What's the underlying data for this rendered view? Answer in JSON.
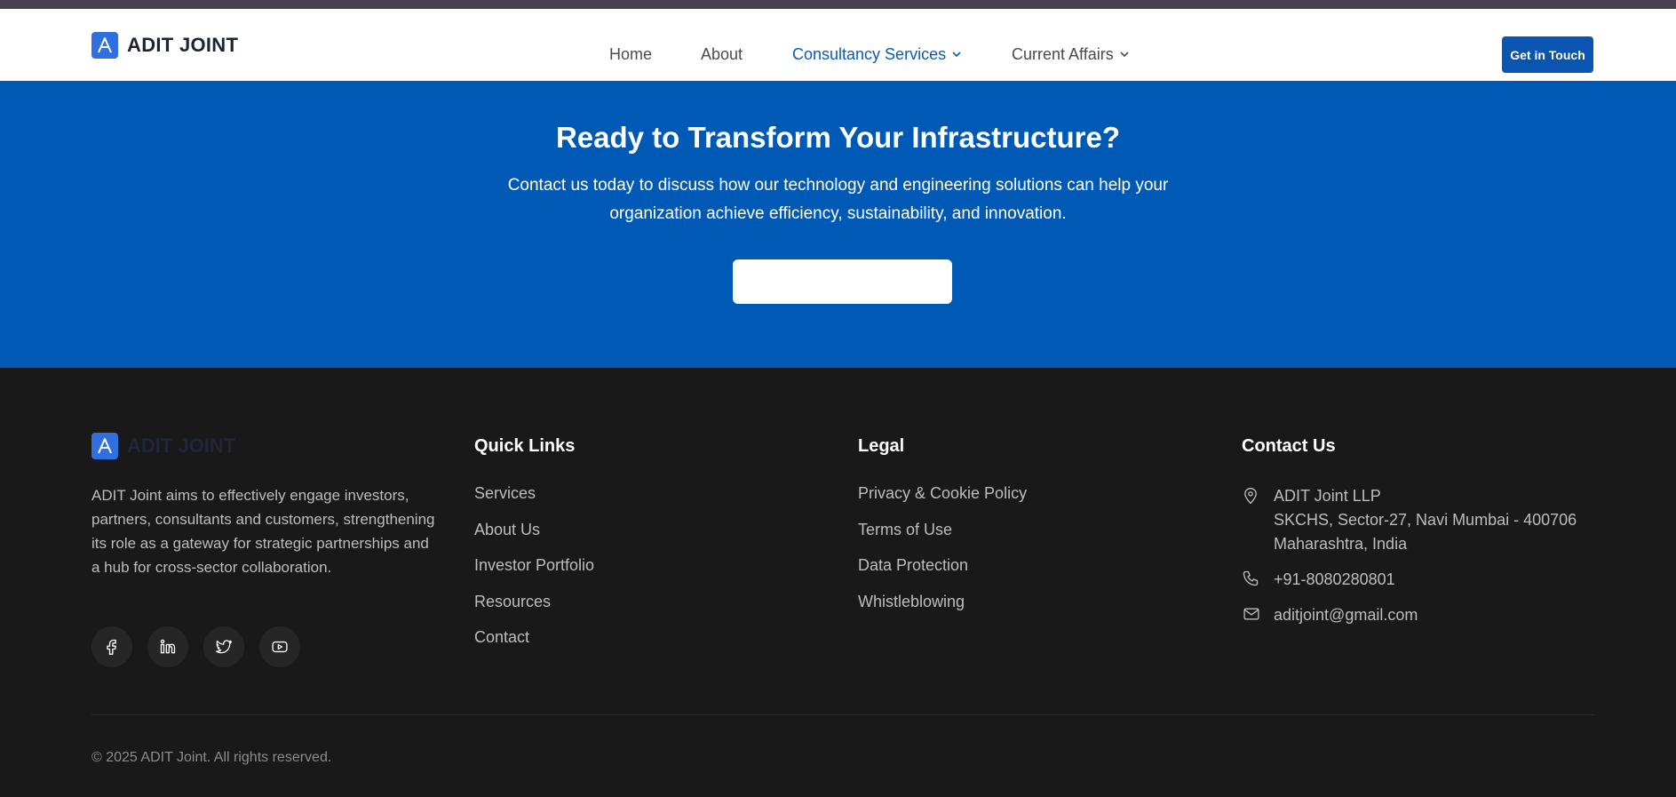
{
  "brand": {
    "name": "ADIT JOINT",
    "logo_letter": "A"
  },
  "nav": {
    "links": [
      {
        "label": "Home"
      },
      {
        "label": "About"
      },
      {
        "label": "Consultancy Services"
      },
      {
        "label": "Current Affairs"
      }
    ],
    "cta_label": "Get in Touch"
  },
  "hero": {
    "title": "Ready to Transform Your Infrastructure?",
    "subtitle": "Contact us today to discuss how our technology and engineering solutions can help your organization achieve efficiency, sustainability, and innovation.",
    "button_label": ""
  },
  "footer": {
    "brand_name": "ADIT JOINT",
    "about": "ADIT Joint aims to effectively engage investors, partners, consultants and customers, strengthening its role as a gateway for strategic partnerships and a hub for cross-sector collaboration.",
    "quick_links": {
      "title": "Quick Links",
      "items": [
        "Services",
        "About Us",
        "Investor Portfolio",
        "Resources",
        "Contact"
      ]
    },
    "legal": {
      "title": "Legal",
      "items": [
        "Privacy & Cookie Policy",
        "Terms of Use",
        "Data Protection",
        "Whistleblowing"
      ]
    },
    "contact": {
      "title": "Contact Us",
      "company": "ADIT Joint LLP",
      "address_line1": "SKCHS, Sector-27, Navi Mumbai - 400706",
      "address_line2": "Maharashtra, India",
      "phone": "+91-8080280801",
      "email": "aditjoint@gmail.com"
    },
    "socials": [
      "facebook-icon",
      "linkedin-icon",
      "twitter-icon",
      "youtube-icon"
    ],
    "copyright": "© 2025 ADIT Joint. All rights reserved."
  },
  "colors": {
    "primary": "#005ab5",
    "footer_bg": "#191919",
    "logo_blue": "#2f6fe0",
    "active_nav": "#0b5bb6"
  }
}
